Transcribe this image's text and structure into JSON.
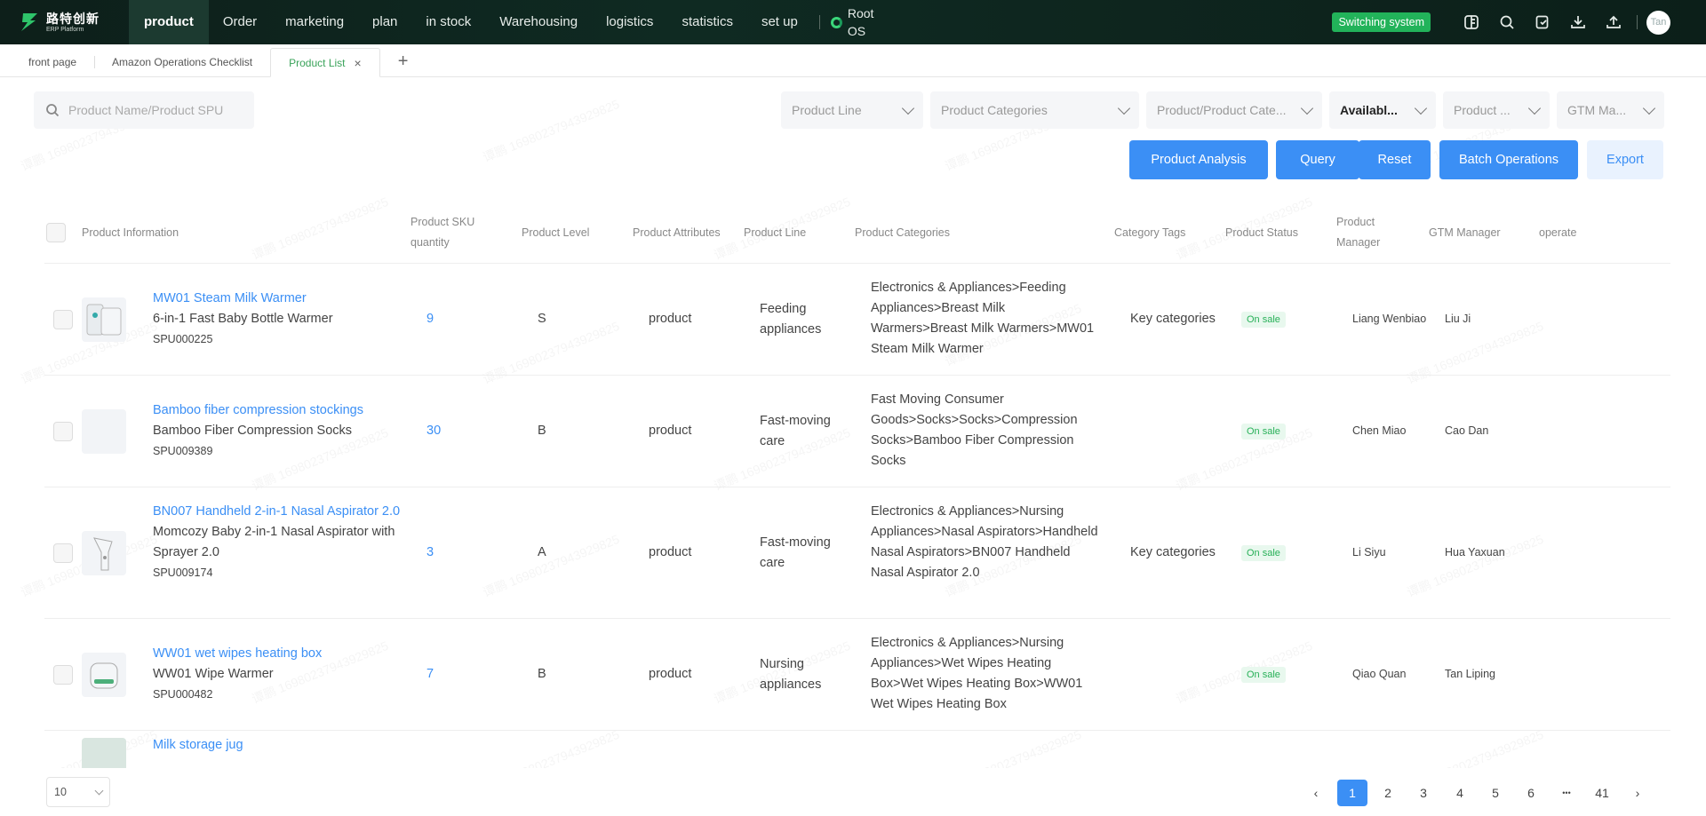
{
  "logo": {
    "cn": "路特创新",
    "en": "ERP Platform"
  },
  "nav": {
    "items": [
      "product",
      "Order",
      "marketing",
      "plan",
      "in stock",
      "Warehousing",
      "logistics",
      "statistics",
      "set up"
    ],
    "root_os": "Root OS"
  },
  "header_tools": {
    "switch_label": "Switching system",
    "avatar": "Tan"
  },
  "tabs": [
    {
      "label": "front page"
    },
    {
      "label": "Amazon Operations Checklist"
    },
    {
      "label": "Product List"
    }
  ],
  "filters": {
    "search_placeholder": "Product Name/Product SPU",
    "product_line": "Product Line",
    "product_categories": "Product Categories",
    "product_product_cate": "Product/Product Cate...",
    "availability": "Availabl...",
    "product_manager": "Product ...",
    "gtm_manager": "GTM Ma..."
  },
  "buttons": {
    "analysis": "Product Analysis",
    "query": "Query",
    "reset": "Reset",
    "batch": "Batch Operations",
    "export": "Export"
  },
  "columns": {
    "info": "Product Information",
    "sku_qty_1": "Product SKU",
    "sku_qty_2": "quantity",
    "level": "Product Level",
    "attributes": "Product Attributes",
    "line": "Product Line",
    "categories": "Product Categories",
    "tags": "Category Tags",
    "status": "Product Status",
    "manager_1": "Product",
    "manager_2": "Manager",
    "gtm": "GTM Manager",
    "operate": "operate"
  },
  "rows": [
    {
      "name": "MW01 Steam Milk Warmer",
      "sub": "6-in-1 Fast Baby Bottle Warmer",
      "spu": "SPU000225",
      "sku": "9",
      "level": "S",
      "attr": "product",
      "line": "Feeding appliances",
      "cat": "Electronics & Appliances>Feeding Appliances>Breast Milk Warmers>Breast Milk Warmers>MW01 Steam Milk Warmer",
      "tag": "Key categories",
      "status": "On sale",
      "manager": "Liang Wenbiao",
      "gtm": "Liu Ji"
    },
    {
      "name": "Bamboo fiber compression stockings",
      "sub": "Bamboo Fiber Compression Socks",
      "spu": "SPU009389",
      "sku": "30",
      "level": "B",
      "attr": "product",
      "line": "Fast-moving care",
      "cat": "Fast Moving Consumer Goods>Socks>Socks>Compression Socks>Bamboo Fiber Compression Socks",
      "tag": "",
      "status": "On sale",
      "manager": "Chen Miao",
      "gtm": "Cao Dan"
    },
    {
      "name": "BN007 Handheld 2-in-1 Nasal Aspirator 2.0",
      "sub": "Momcozy Baby 2-in-1 Nasal Aspirator with Sprayer 2.0",
      "spu": "SPU009174",
      "sku": "3",
      "level": "A",
      "attr": "product",
      "line": "Fast-moving care",
      "cat": "Electronics & Appliances>Nursing Appliances>Nasal Aspirators>Handheld Nasal Aspirators>BN007 Handheld Nasal Aspirator 2.0",
      "tag": "Key categories",
      "status": "On sale",
      "manager": "Li Siyu",
      "gtm": "Hua Yaxuan"
    },
    {
      "name": "WW01 wet wipes heating box",
      "sub": "WW01 Wipe Warmer",
      "spu": "SPU000482",
      "sku": "7",
      "level": "B",
      "attr": "product",
      "line": "Nursing appliances",
      "cat": "Electronics & Appliances>Nursing Appliances>Wet Wipes Heating Box>Wet Wipes Heating Box>WW01 Wet Wipes Heating Box",
      "tag": "",
      "status": "On sale",
      "manager": "Qiao Quan",
      "gtm": "Tan Liping"
    },
    {
      "name": "Milk storage jug"
    }
  ],
  "pagination": {
    "page_size": "10",
    "pages": [
      "1",
      "2",
      "3",
      "4",
      "5",
      "6",
      "•••",
      "41"
    ]
  },
  "watermark": "谭鹏 16980237943929825",
  "colors": {
    "accent": "#3b8ff5",
    "nav_bg": "#0f2a22",
    "success": "#22b35a"
  }
}
